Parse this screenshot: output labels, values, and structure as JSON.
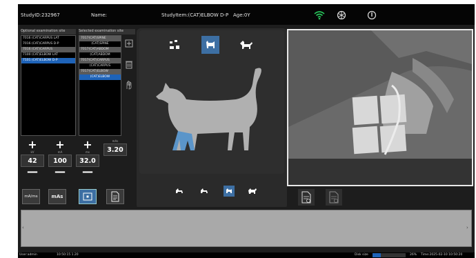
{
  "topbar": {
    "study_id": "StudyID:232967",
    "name": "Name:",
    "study_item": "StudyItem:(CAT)ELBOW D-P",
    "age": "Age:0Y"
  },
  "left": {
    "optional_header": "Optional examination site",
    "selected_header": "Selected examination site",
    "optional_items": [
      "7016 (CAT)CARPUS LAT",
      "7016 (CAT)CARPUS D-P",
      "7016 (CAT)CARPUS",
      "7100 (CAT)ELBOW LAT",
      "7101 (CAT)ELBOW D-P"
    ],
    "selected_items": [
      "7017(CAT)SPINE",
      "(CAT)SPINE",
      "7017(CAT)ABDOM",
      "(CAT)ABDOM",
      "7017(CAT)CARPUS",
      "(CAT)CARPUS",
      "7017(CAT)ELBOW",
      "(CAT)ELBOW"
    ]
  },
  "params": [
    {
      "unit": "kV",
      "value": "42",
      "plus": "+",
      "minus": "—"
    },
    {
      "unit": "mA",
      "value": "100",
      "plus": "+",
      "minus": "—"
    },
    {
      "unit": "ms",
      "value": "32.0",
      "plus": "+",
      "minus": "—"
    },
    {
      "unit": "mAs",
      "value": "3.20",
      "plus": "",
      "minus": ""
    }
  ],
  "buttons": {
    "mode_kv_mas": "mA/ms",
    "mode_mas": "mAs"
  },
  "status": {
    "user": "User:admin",
    "time_left": "10:50:15 1.20",
    "disk_label": "Disk size",
    "disk_percent": "26%",
    "time": "Time:2025-02-10 10:50:20"
  },
  "colors": {
    "accent": "#1e63b8",
    "wifi": "#27c45a",
    "leg_highlight": "#5b95c9"
  }
}
